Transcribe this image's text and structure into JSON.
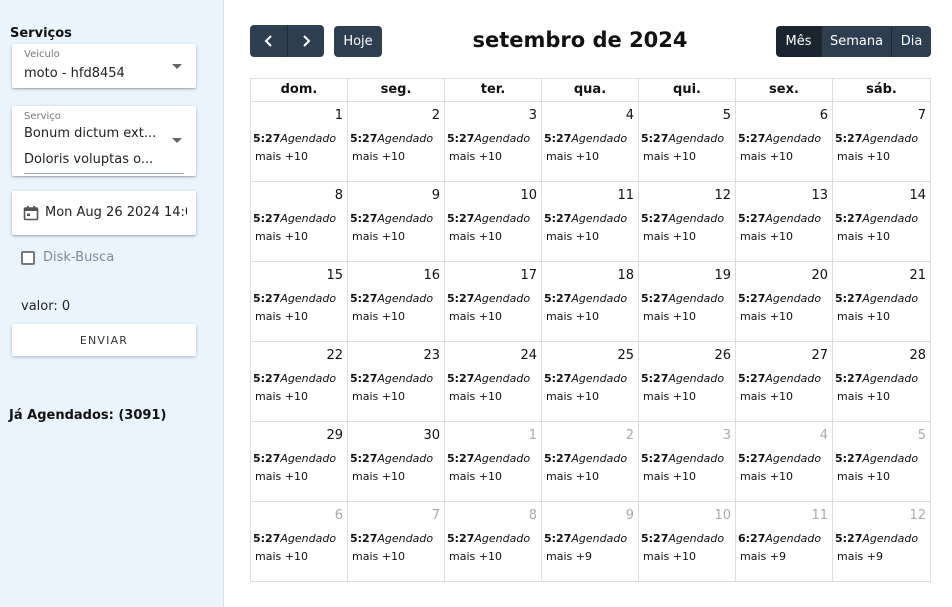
{
  "sidebar": {
    "title": "Serviços",
    "vehicle": {
      "label": "Veiculo",
      "value": "moto - hfd8454"
    },
    "service": {
      "label": "Serviço",
      "values": [
        "Bonum dictum ext...",
        "Doloris voluptas o..."
      ]
    },
    "date": {
      "value": "Mon Aug 26 2024 14:0"
    },
    "disk_busca": {
      "label": "Disk-Busca",
      "checked": false
    },
    "valor": "valor: 0",
    "send_label": "ENVIAR",
    "agendados": "Já Agendados: (3091)"
  },
  "calendar": {
    "today_label": "Hoje",
    "title": "setembro de 2024",
    "views": [
      {
        "label": "Mês",
        "active": true
      },
      {
        "label": "Semana",
        "active": false
      },
      {
        "label": "Dia",
        "active": false
      }
    ],
    "day_headers": [
      "dom.",
      "seg.",
      "ter.",
      "qua.",
      "qui.",
      "sex.",
      "sáb."
    ],
    "weeks": [
      [
        {
          "day": "1",
          "other": false,
          "time": "5:27",
          "title": "Agendado",
          "more": "mais +10"
        },
        {
          "day": "2",
          "other": false,
          "time": "5:27",
          "title": "Agendado",
          "more": "mais +10"
        },
        {
          "day": "3",
          "other": false,
          "time": "5:27",
          "title": "Agendado",
          "more": "mais +10"
        },
        {
          "day": "4",
          "other": false,
          "time": "5:27",
          "title": "Agendado",
          "more": "mais +10"
        },
        {
          "day": "5",
          "other": false,
          "time": "5:27",
          "title": "Agendado",
          "more": "mais +10"
        },
        {
          "day": "6",
          "other": false,
          "time": "5:27",
          "title": "Agendado",
          "more": "mais +10"
        },
        {
          "day": "7",
          "other": false,
          "time": "5:27",
          "title": "Agendado",
          "more": "mais +10"
        }
      ],
      [
        {
          "day": "8",
          "other": false,
          "time": "5:27",
          "title": "Agendado",
          "more": "mais +10"
        },
        {
          "day": "9",
          "other": false,
          "time": "5:27",
          "title": "Agendado",
          "more": "mais +10"
        },
        {
          "day": "10",
          "other": false,
          "time": "5:27",
          "title": "Agendado",
          "more": "mais +10"
        },
        {
          "day": "11",
          "other": false,
          "time": "5:27",
          "title": "Agendado",
          "more": "mais +10"
        },
        {
          "day": "12",
          "other": false,
          "time": "5:27",
          "title": "Agendado",
          "more": "mais +10"
        },
        {
          "day": "13",
          "other": false,
          "time": "5:27",
          "title": "Agendado",
          "more": "mais +10"
        },
        {
          "day": "14",
          "other": false,
          "time": "5:27",
          "title": "Agendado",
          "more": "mais +10"
        }
      ],
      [
        {
          "day": "15",
          "other": false,
          "time": "5:27",
          "title": "Agendado",
          "more": "mais +10"
        },
        {
          "day": "16",
          "other": false,
          "time": "5:27",
          "title": "Agendado",
          "more": "mais +10"
        },
        {
          "day": "17",
          "other": false,
          "time": "5:27",
          "title": "Agendado",
          "more": "mais +10"
        },
        {
          "day": "18",
          "other": false,
          "time": "5:27",
          "title": "Agendado",
          "more": "mais +10"
        },
        {
          "day": "19",
          "other": false,
          "time": "5:27",
          "title": "Agendado",
          "more": "mais +10"
        },
        {
          "day": "20",
          "other": false,
          "time": "5:27",
          "title": "Agendado",
          "more": "mais +10"
        },
        {
          "day": "21",
          "other": false,
          "time": "5:27",
          "title": "Agendado",
          "more": "mais +10"
        }
      ],
      [
        {
          "day": "22",
          "other": false,
          "time": "5:27",
          "title": "Agendado",
          "more": "mais +10"
        },
        {
          "day": "23",
          "other": false,
          "time": "5:27",
          "title": "Agendado",
          "more": "mais +10"
        },
        {
          "day": "24",
          "other": false,
          "time": "5:27",
          "title": "Agendado",
          "more": "mais +10"
        },
        {
          "day": "25",
          "other": false,
          "time": "5:27",
          "title": "Agendado",
          "more": "mais +10"
        },
        {
          "day": "26",
          "other": false,
          "time": "5:27",
          "title": "Agendado",
          "more": "mais +10"
        },
        {
          "day": "27",
          "other": false,
          "time": "5:27",
          "title": "Agendado",
          "more": "mais +10"
        },
        {
          "day": "28",
          "other": false,
          "time": "5:27",
          "title": "Agendado",
          "more": "mais +10"
        }
      ],
      [
        {
          "day": "29",
          "other": false,
          "time": "5:27",
          "title": "Agendado",
          "more": "mais +10"
        },
        {
          "day": "30",
          "other": false,
          "time": "5:27",
          "title": "Agendado",
          "more": "mais +10"
        },
        {
          "day": "1",
          "other": true,
          "time": "5:27",
          "title": "Agendado",
          "more": "mais +10"
        },
        {
          "day": "2",
          "other": true,
          "time": "5:27",
          "title": "Agendado",
          "more": "mais +10"
        },
        {
          "day": "3",
          "other": true,
          "time": "5:27",
          "title": "Agendado",
          "more": "mais +10"
        },
        {
          "day": "4",
          "other": true,
          "time": "5:27",
          "title": "Agendado",
          "more": "mais +10"
        },
        {
          "day": "5",
          "other": true,
          "time": "5:27",
          "title": "Agendado",
          "more": "mais +10"
        }
      ],
      [
        {
          "day": "6",
          "other": true,
          "time": "5:27",
          "title": "Agendado",
          "more": "mais +10"
        },
        {
          "day": "7",
          "other": true,
          "time": "5:27",
          "title": "Agendado",
          "more": "mais +10"
        },
        {
          "day": "8",
          "other": true,
          "time": "5:27",
          "title": "Agendado",
          "more": "mais +10"
        },
        {
          "day": "9",
          "other": true,
          "time": "5:27",
          "title": "Agendado",
          "more": "mais +9"
        },
        {
          "day": "10",
          "other": true,
          "time": "5:27",
          "title": "Agendado",
          "more": "mais +10"
        },
        {
          "day": "11",
          "other": true,
          "time": "6:27",
          "title": "Agendado",
          "more": "mais +9"
        },
        {
          "day": "12",
          "other": true,
          "time": "5:27",
          "title": "Agendado",
          "more": "mais +9"
        }
      ]
    ]
  },
  "colors": {
    "sidebar_bg": "#e9f4fd",
    "button_bg": "#2c3e50",
    "button_active": "#1a252f"
  }
}
